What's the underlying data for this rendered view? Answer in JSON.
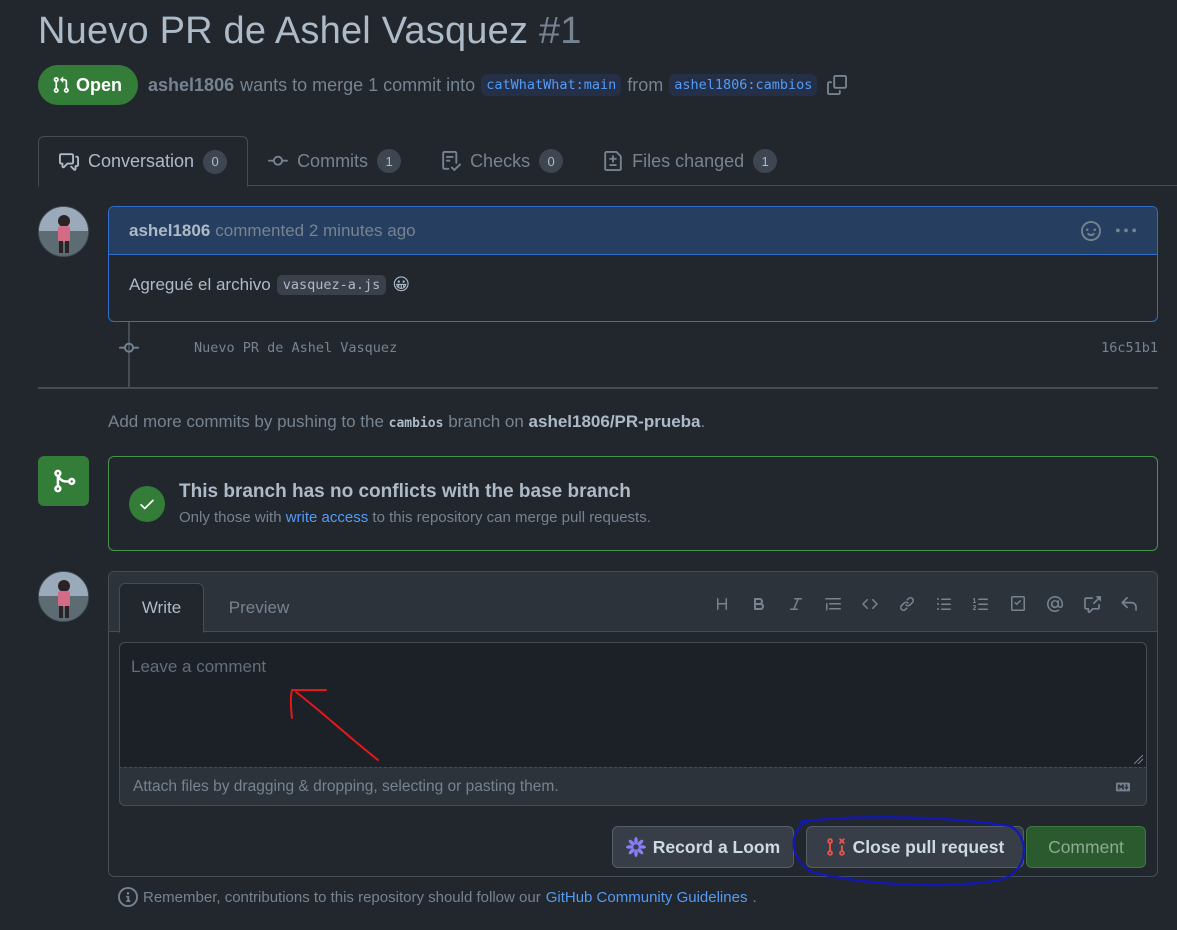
{
  "pr": {
    "title": "Nuevo PR de Ashel Vasquez",
    "number": "#1",
    "state": "Open",
    "author": "ashel1806",
    "merge_text": "wants to merge 1 commit into",
    "base_branch": "catWhatWhat:main",
    "from_text": "from",
    "head_branch": "ashel1806:cambios"
  },
  "tabs": [
    {
      "label": "Conversation",
      "count": "0"
    },
    {
      "label": "Commits",
      "count": "1"
    },
    {
      "label": "Checks",
      "count": "0"
    },
    {
      "label": "Files changed",
      "count": "1"
    }
  ],
  "comment": {
    "author": "ashel1806",
    "meta": "commented 2 minutes ago",
    "body": "Agregué el archivo",
    "code": "vasquez-a.js",
    "emoji": "😀"
  },
  "commit": {
    "message": "Nuevo PR de Ashel Vasquez",
    "sha": "16c51b1"
  },
  "hint": {
    "prefix": "Add more commits by pushing to the",
    "branch": "cambios",
    "middle": "branch on",
    "repo": "ashel1806/PR-prueba",
    "suffix": "."
  },
  "merge_status": {
    "title": "This branch has no conflicts with the base branch",
    "sub_prefix": "Only those with",
    "sub_link": "write access",
    "sub_suffix": "to this repository can merge pull requests."
  },
  "editor": {
    "write_tab": "Write",
    "preview_tab": "Preview",
    "placeholder": "Leave a comment",
    "attach_text": "Attach files by dragging & dropping, selecting or pasting them."
  },
  "buttons": {
    "loom": "Record a Loom",
    "close": "Close pull request",
    "comment": "Comment"
  },
  "footer": {
    "prefix": "Remember, contributions to this repository should follow our",
    "link": "GitHub Community Guidelines",
    "suffix": "."
  },
  "colors": {
    "background": "#22272e",
    "open_green": "#347d39",
    "link_blue": "#539bf5",
    "annotation_red": "#e8161b",
    "annotation_blue": "#1217b8"
  },
  "icons": [
    "pull-request-icon",
    "copy-icon",
    "conversation-icon",
    "commit-icon",
    "checks-icon",
    "files-diff-icon",
    "smiley-icon",
    "kebab-icon",
    "git-merge-icon",
    "check-icon",
    "heading-icon",
    "bold-icon",
    "italic-icon",
    "quote-icon",
    "code-icon",
    "link-icon",
    "bulleted-list-icon",
    "numbered-list-icon",
    "task-list-icon",
    "mention-icon",
    "cross-reference-icon",
    "reply-icon",
    "markdown-icon",
    "loom-icon",
    "close-pr-icon",
    "info-icon"
  ]
}
